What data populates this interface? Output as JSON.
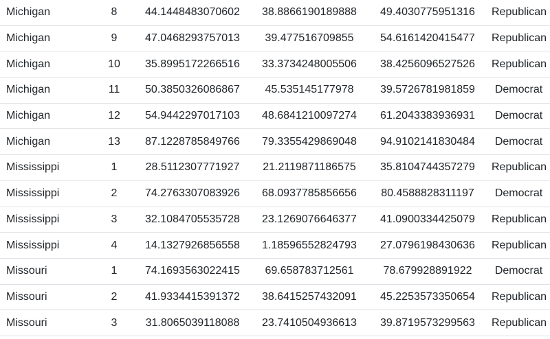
{
  "table": {
    "rows": [
      [
        "Michigan",
        "8",
        "44.1448483070602",
        "38.8866190189888",
        "49.4030775951316",
        "Republican"
      ],
      [
        "Michigan",
        "9",
        "47.0468293757013",
        "39.477516709855",
        "54.6161420415477",
        "Republican"
      ],
      [
        "Michigan",
        "10",
        "35.8995172266516",
        "33.3734248005506",
        "38.4256096527526",
        "Republican"
      ],
      [
        "Michigan",
        "11",
        "50.3850326086867",
        "45.535145177978",
        "39.5726781981859",
        "Democrat"
      ],
      [
        "Michigan",
        "12",
        "54.9442297017103",
        "48.6841210097274",
        "61.2043383936931",
        "Democrat"
      ],
      [
        "Michigan",
        "13",
        "87.1228785849766",
        "79.3355429869048",
        "94.9102141830484",
        "Democrat"
      ],
      [
        "Mississippi",
        "1",
        "28.5112307771927",
        "21.2119871186575",
        "35.8104744357279",
        "Republican"
      ],
      [
        "Mississippi",
        "2",
        "74.2763307083926",
        "68.0937785856656",
        "80.4588828311197",
        "Democrat"
      ],
      [
        "Mississippi",
        "3",
        "32.1084705535728",
        "23.1269076646377",
        "41.0900334425079",
        "Republican"
      ],
      [
        "Mississippi",
        "4",
        "14.1327926856558",
        "1.18596552824793",
        "27.0796198430636",
        "Republican"
      ],
      [
        "Missouri",
        "1",
        "74.1693563022415",
        "69.658783712561",
        "78.679928891922",
        "Democrat"
      ],
      [
        "Missouri",
        "2",
        "41.9334415391372",
        "38.6415257432091",
        "45.2253573350654",
        "Republican"
      ],
      [
        "Missouri",
        "3",
        "31.8065039118088",
        "23.7410504936613",
        "39.8719573299563",
        "Republican"
      ]
    ]
  }
}
